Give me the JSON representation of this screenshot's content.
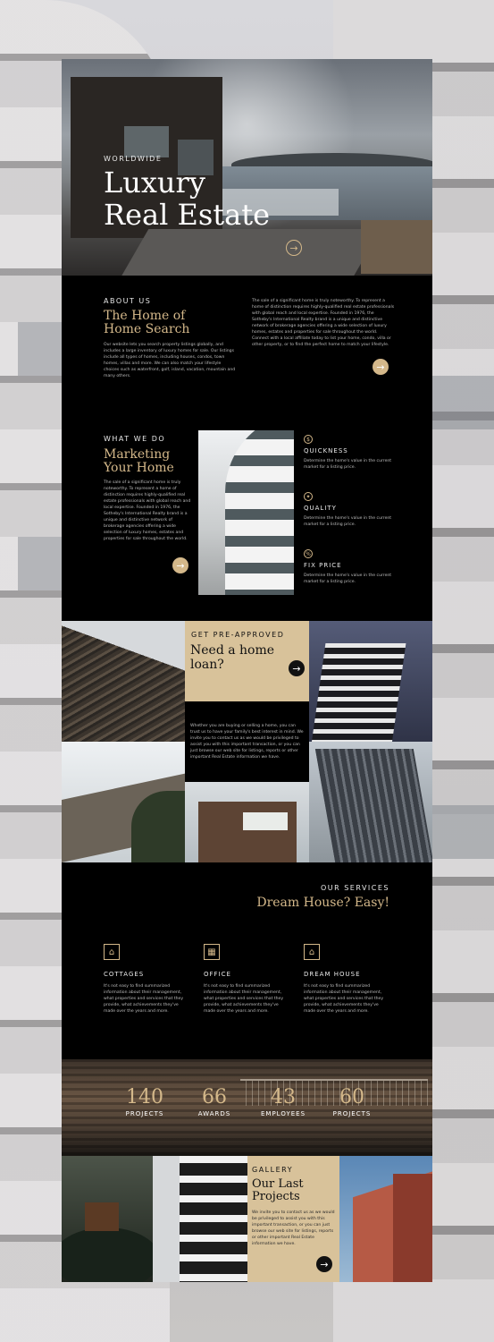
{
  "hero": {
    "kicker": "WORLDWIDE",
    "title_line1": "Luxury",
    "title_line2": "Real Estate",
    "arrow": "→"
  },
  "about": {
    "kicker": "ABOUT US",
    "title_line1": "The Home of",
    "title_line2": "Home Search",
    "text_left": "Our website lets you search property listings globally, and includes a large inventory of luxury homes for sale. Our listings include all types of homes, including houses, condos, town homes, villas and more. We can also match your lifestyle choices such as waterfront, golf, island, vacation, mountain and many others.",
    "text_right": "The sale of a significant home is truly noteworthy. To represent a home of distinction requires highly-qualified real estate professionals with global reach and local expertise. Founded in 1976, the Sotheby's International Realty brand is a unique and distinctive network of brokerage agencies offering a wide selection of luxury homes, estates and properties for sale throughout the world. Connect with a local affiliate today to list your home, condo, villa or other property, or to find the perfect home to match your lifestyle.",
    "arrow": "→"
  },
  "what_we_do": {
    "kicker": "WHAT WE DO",
    "title_line1": "Marketing",
    "title_line2": "Your Home",
    "text": "The sale of a significant home is truly noteworthy. To represent a home of distinction requires highly-qualified real estate professionals with global reach and local expertise. Founded in 1976, the Sotheby's International Realty brand is a unique and distinctive network of brokerage agencies offering a wide selection of luxury homes, estates and properties for sale throughout the world.",
    "arrow": "→",
    "features": [
      {
        "icon": "$",
        "title": "QUICKNESS",
        "text": "Determine the home's value in the current market for a listing price."
      },
      {
        "icon": "✦",
        "title": "QUALITY",
        "text": "Determine the home's value in the current market for a listing price."
      },
      {
        "icon": "%",
        "title": "FIX PRICE",
        "text": "Determine the home's value in the current market for a listing price."
      }
    ]
  },
  "loan": {
    "kicker": "GET PRE-APPROVED",
    "title": "Need a home loan?",
    "arrow": "→",
    "text": "Whether you are buying or selling a home, you can trust us to have your family's best interest in mind. We invite you to contact us as we would be privileged to assist you with this important transaction, or you can just browse our web site for listings, reports or other important Real Estate information we have."
  },
  "services": {
    "kicker": "OUR SERVICES",
    "title": "Dream House? Easy!",
    "items": [
      {
        "icon": "⌂",
        "title": "COTTAGES",
        "text": "It's not easy to find summarized information about their management, what properties and services that they provide, what achievements they've made over the years and more."
      },
      {
        "icon": "▦",
        "title": "OFFICE",
        "text": "It's not easy to find summarized information about their management, what properties and services that they provide, what achievements they've made over the years and more."
      },
      {
        "icon": "⌂",
        "title": "DREAM HOUSE",
        "text": "It's not easy to find summarized information about their management, what properties and services that they provide, what achievements they've made over the years and more."
      }
    ]
  },
  "stats": [
    {
      "number": "140",
      "label": "PROJECTS"
    },
    {
      "number": "66",
      "label": "AWARDS"
    },
    {
      "number": "43",
      "label": "EMPLOYEES"
    },
    {
      "number": "60",
      "label": "PROJECTS"
    }
  ],
  "gallery": {
    "kicker": "GALLERY",
    "title_line1": "Our Last",
    "title_line2": "Projects",
    "text": "We invite you to contact us as we would be privileged to assist you with this important transaction, or you can just browse our web site for listings, reports or other important Real Estate information we have.",
    "arrow": "→"
  },
  "colors": {
    "accent": "#d4b88a",
    "panel": "#d8c29a",
    "background": "#000000"
  }
}
